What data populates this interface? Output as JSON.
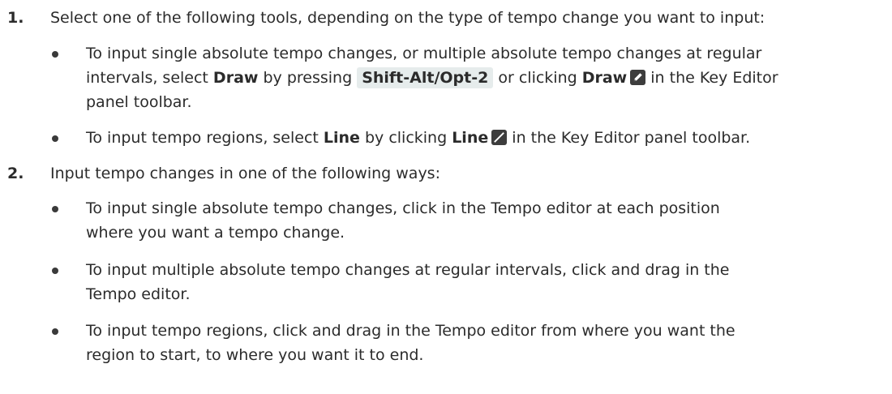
{
  "steps": [
    {
      "number": "1.",
      "text": "Select one of the following tools, depending on the type of tempo change you want to input:",
      "bullets": [
        {
          "line1_part1": "To input single absolute tempo changes, or multiple absolute tempo changes at regular",
          "line2_part1": "intervals, select ",
          "draw_label": "Draw",
          "line2_part2": " by pressing ",
          "shortcut": "Shift-Alt/Opt-2",
          "line2_part3": " or clicking ",
          "draw_label_2": "Draw",
          "line2_part4": " in the Key Editor",
          "line3": "panel toolbar."
        },
        {
          "part1": "To input tempo regions, select ",
          "line_label": "Line",
          "part2": " by clicking ",
          "line_label_2": "Line",
          "part3": " in the Key Editor panel toolbar."
        }
      ]
    },
    {
      "number": "2.",
      "text": "Input tempo changes in one of the following ways:",
      "bullets": [
        {
          "line1": "To input single absolute tempo changes, click in the Tempo editor at each position",
          "line2": "where you want a tempo change."
        },
        {
          "line1": "To input multiple absolute tempo changes at regular intervals, click and drag in the",
          "line2": "Tempo editor."
        },
        {
          "line1": "To input tempo regions, click and drag in the Tempo editor from where you want the",
          "line2": "region to start, to where you want it to end."
        }
      ]
    }
  ],
  "icons": {
    "draw": "pencil-icon",
    "line": "line-tool-icon",
    "icon_color": "#3d3d3d"
  },
  "colors": {
    "text": "#2b2b2b",
    "shortcut_bg": "#e6ecec"
  }
}
